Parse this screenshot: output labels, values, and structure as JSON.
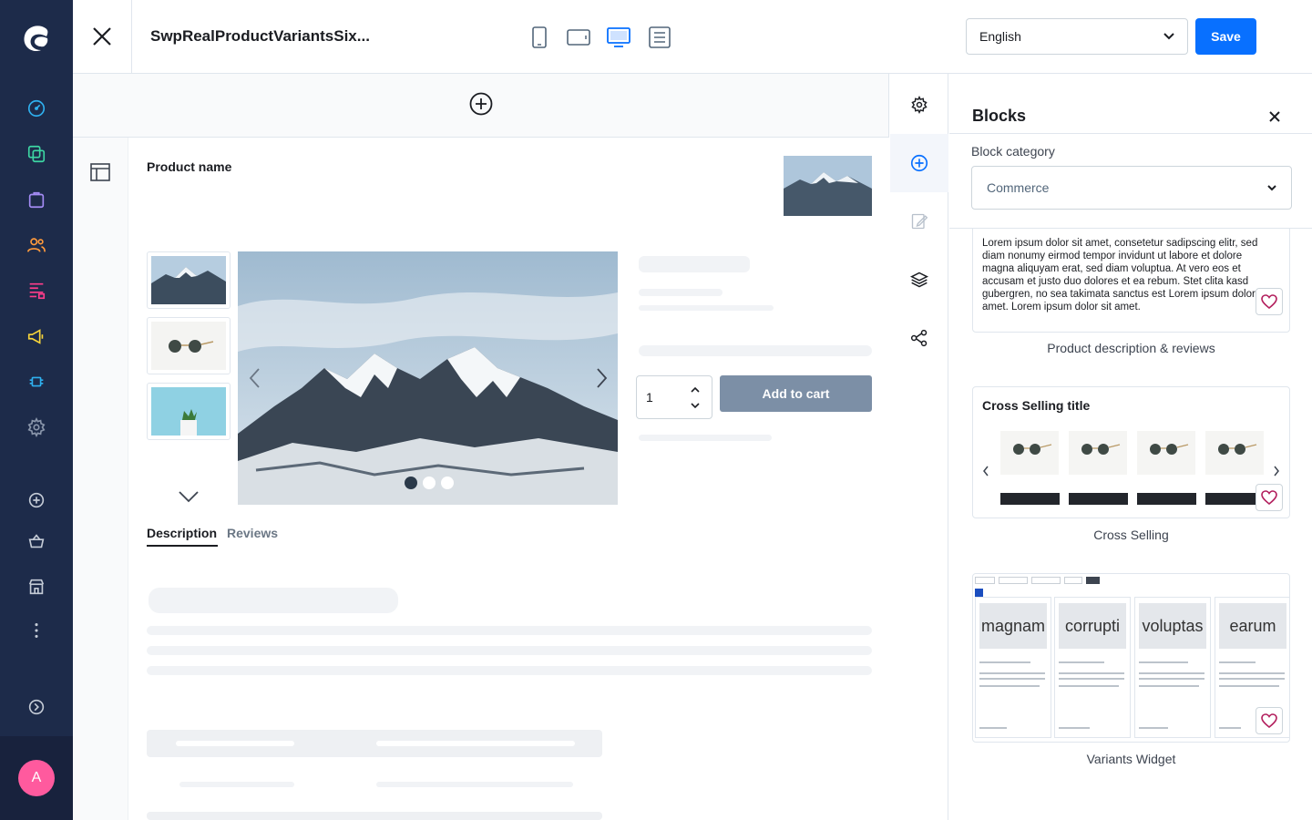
{
  "topbar": {
    "page_title": "SwpRealProductVariantsSix...",
    "language": "English",
    "save_label": "Save"
  },
  "colors": {
    "nav_bg": "#1d2b4a",
    "primary": "#0870ff",
    "avatar": "#ff5a9e"
  },
  "nav": {
    "avatar_initial": "A",
    "icons": [
      "dashboard-icon",
      "catalogue-icon",
      "orders-icon",
      "customers-icon",
      "content-icon",
      "marketing-icon",
      "extensions-icon",
      "settings-icon",
      "add-icon",
      "shop-basket-icon",
      "sales-channel-icon",
      "more-icon",
      "expand-icon"
    ]
  },
  "canvas": {
    "product_name": "Product name",
    "quantity": "1",
    "add_to_cart": "Add to cart",
    "tabs": [
      "Description",
      "Reviews"
    ]
  },
  "panel": {
    "title": "Blocks",
    "category_label": "Block category",
    "category_value": "Commerce",
    "blocks": [
      {
        "label": "Product description & reviews",
        "text": "Lorem ipsum dolor sit amet, consetetur sadipscing elitr, sed diam nonumy eirmod tempor invidunt ut labore et dolore magna aliquyam erat, sed diam voluptua. At vero eos et accusam et justo duo dolores et ea rebum. Stet clita kasd gubergren, no sea takimata sanctus est Lorem ipsum dolor sit amet. Lorem ipsum dolor sit amet."
      },
      {
        "label": "Cross Selling",
        "title": "Cross Selling title"
      },
      {
        "label": "Variants Widget",
        "columns": [
          "magnam",
          "corrupti",
          "voluptas",
          "earum"
        ]
      }
    ]
  }
}
